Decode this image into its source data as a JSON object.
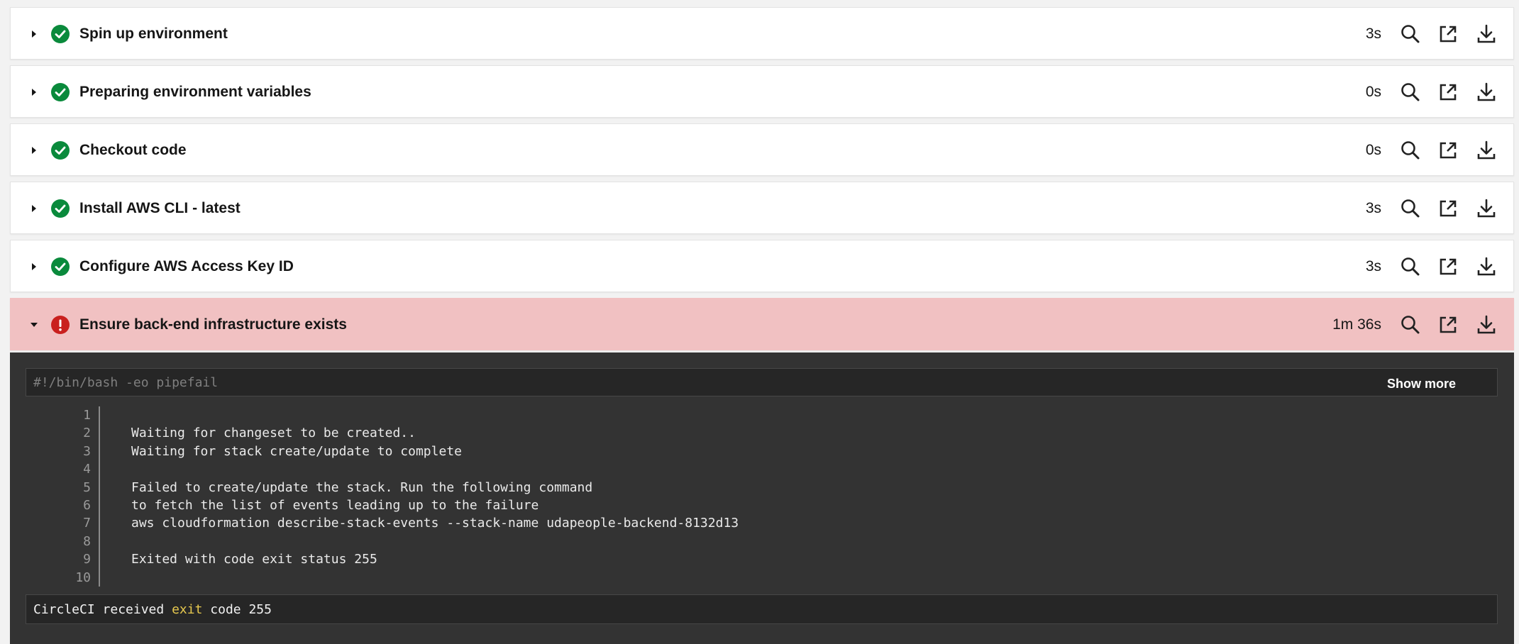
{
  "colors": {
    "success": "#0a8a3c",
    "failed": "#c9201e",
    "failed_row_bg": "#f1c1c2",
    "terminal_bg": "#333333",
    "keyword": "#e6c84f"
  },
  "steps": [
    {
      "title": "Spin up environment",
      "duration": "3s",
      "status": "success",
      "expanded": false
    },
    {
      "title": "Preparing environment variables",
      "duration": "0s",
      "status": "success",
      "expanded": false
    },
    {
      "title": "Checkout code",
      "duration": "0s",
      "status": "success",
      "expanded": false
    },
    {
      "title": "Install AWS CLI - latest",
      "duration": "3s",
      "status": "success",
      "expanded": false
    },
    {
      "title": "Configure AWS Access Key ID",
      "duration": "3s",
      "status": "success",
      "expanded": false
    },
    {
      "title": "Ensure back-end infrastructure exists",
      "duration": "1m 36s",
      "status": "failed",
      "expanded": true
    }
  ],
  "icons": {
    "expand": "caret-right-icon",
    "collapse": "caret-down-icon",
    "success": "check-circle-icon",
    "failed": "exclamation-circle-icon",
    "search": "search-icon",
    "open": "open-in-new-icon",
    "download": "download-icon"
  },
  "output": {
    "script": "#!/bin/bash -eo pipefail",
    "show_more_label": "Show more",
    "lines": [
      {
        "num": "1",
        "text": ""
      },
      {
        "num": "2",
        "text": "Waiting for changeset to be created.."
      },
      {
        "num": "3",
        "text": "Waiting for stack create/update to complete"
      },
      {
        "num": "4",
        "text": ""
      },
      {
        "num": "5",
        "text": "Failed to create/update the stack. Run the following command"
      },
      {
        "num": "6",
        "text": "to fetch the list of events leading up to the failure"
      },
      {
        "num": "7",
        "text": "aws cloudformation describe-stack-events --stack-name udapeople-backend-8132d13"
      },
      {
        "num": "8",
        "text": ""
      },
      {
        "num": "9",
        "text": "Exited with code exit status 255"
      },
      {
        "num": "10",
        "text": ""
      }
    ],
    "exit_message": {
      "prefix": "CircleCI received ",
      "keyword": "exit",
      "suffix": " code 255"
    }
  }
}
